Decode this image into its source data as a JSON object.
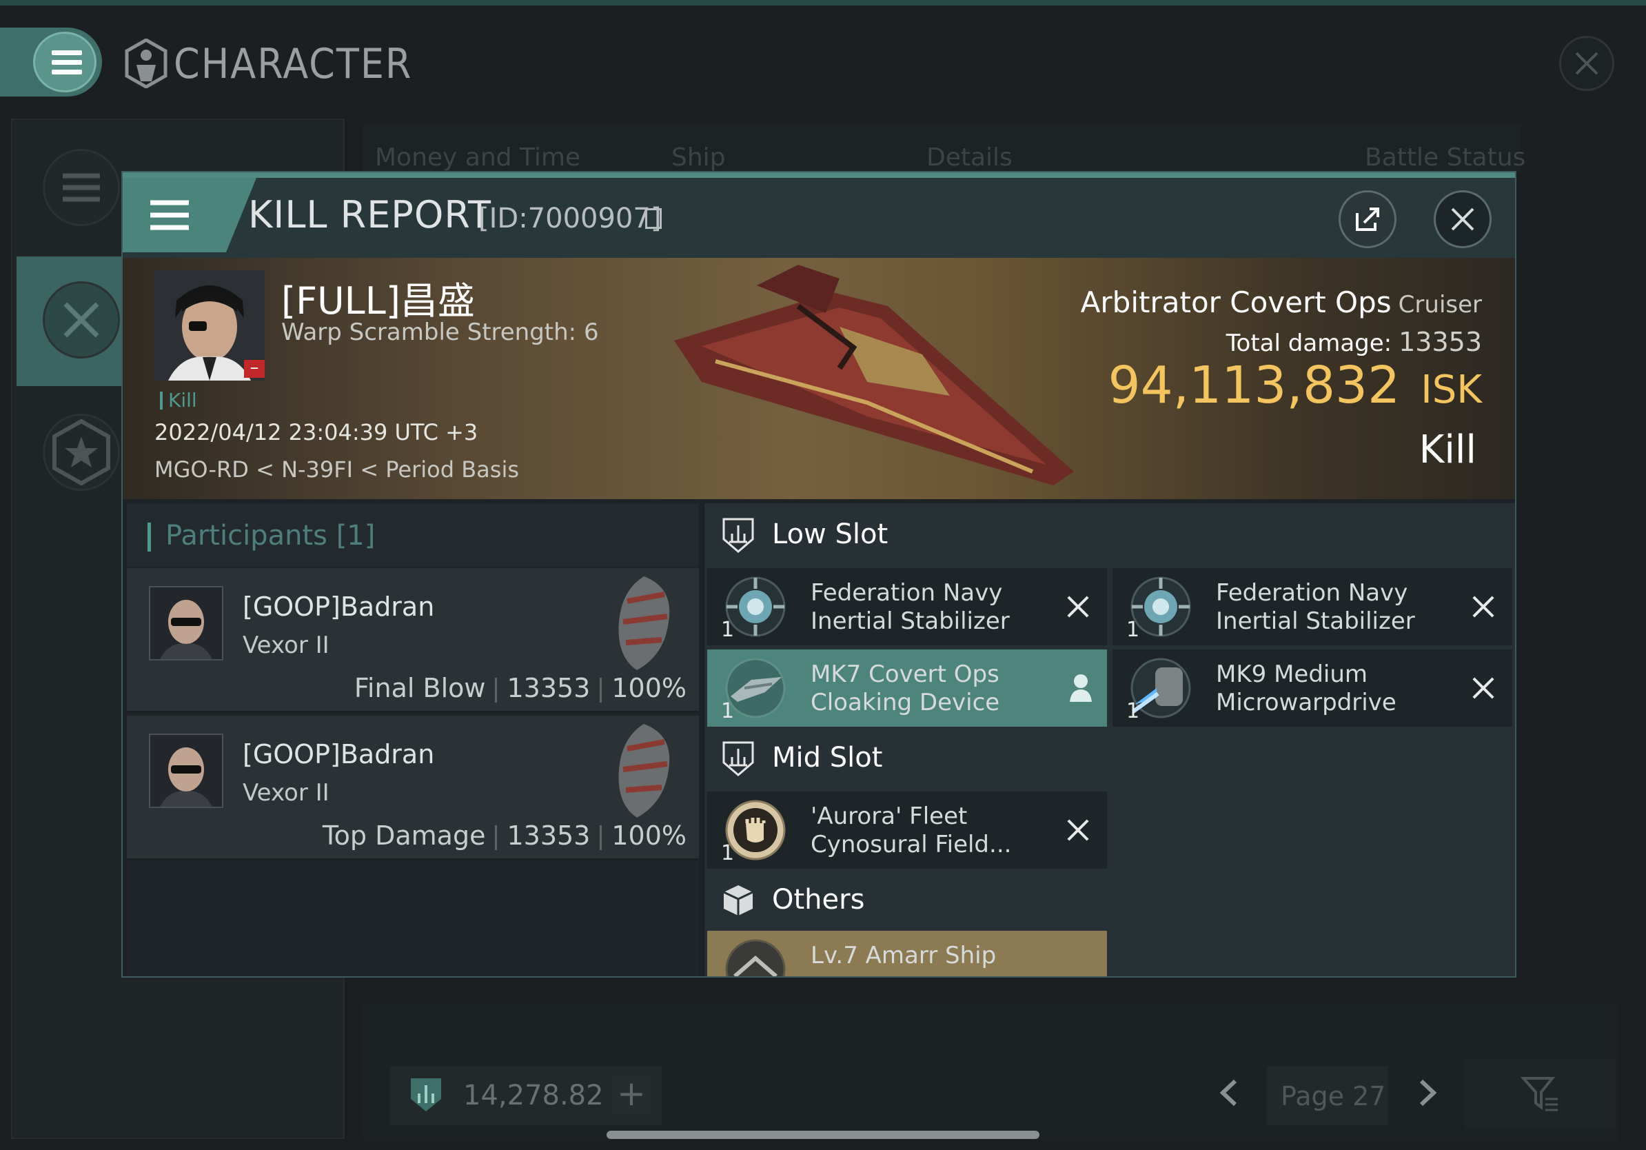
{
  "window": {
    "title": "CHARACTER"
  },
  "bg_tabs": [
    "Money and Time",
    "Ship",
    "Details",
    "Battle Status"
  ],
  "bottom_bar": {
    "isk_value": "14,278.82",
    "add_symbol": "+",
    "page_label": "Page 27"
  },
  "kill_report": {
    "title": "KILL REPORT",
    "id": "[ID:7000907]",
    "victim": {
      "name": "[FULL]昌盛",
      "warp_scramble": "Warp Scramble Strength: 6",
      "tag": "Kill",
      "datetime": "2022/04/12 23:04:39 UTC +3",
      "location": "MGO-RD < N-39FI < Period Basis"
    },
    "ship": {
      "name": "Arbitrator Covert Ops",
      "class": "Cruiser",
      "total_damage_label": "Total damage:",
      "total_damage": "13353",
      "isk_value": "94,113,832",
      "isk_unit": "ISK",
      "result": "Kill"
    },
    "participants": {
      "title": "Participants",
      "count": "[1]",
      "rows": [
        {
          "name": "[GOOP]Badran",
          "ship": "Vexor II",
          "role": "Final Blow",
          "damage": "13353",
          "percent": "100%"
        },
        {
          "name": "[GOOP]Badran",
          "ship": "Vexor II",
          "role": "Top Damage",
          "damage": "13353",
          "percent": "100%"
        }
      ]
    },
    "fitting": {
      "low_slot_title": "Low Slot",
      "mid_slot_title": "Mid Slot",
      "others_title": "Others",
      "low": [
        {
          "name": "Federation Navy\nInertial Stabilizer",
          "qty": "1",
          "status": "destroyed"
        },
        {
          "name": "Federation Navy\nInertial Stabilizer",
          "qty": "1",
          "status": "destroyed"
        },
        {
          "name": "MK7 Covert Ops\nCloaking Device",
          "qty": "1",
          "status": "dropped"
        },
        {
          "name": "MK9 Medium\nMicrowarpdrive",
          "qty": "1",
          "status": "destroyed"
        }
      ],
      "mid": [
        {
          "name": "'Aurora' Fleet\nCynosural Field...",
          "qty": "1",
          "status": "destroyed"
        }
      ],
      "others": [
        {
          "name": "Lv.7 Amarr Ship"
        }
      ]
    }
  },
  "colors": {
    "accent": "#4f8a82",
    "isk_gold": "#f4c45e",
    "danger": "#c2282a"
  }
}
